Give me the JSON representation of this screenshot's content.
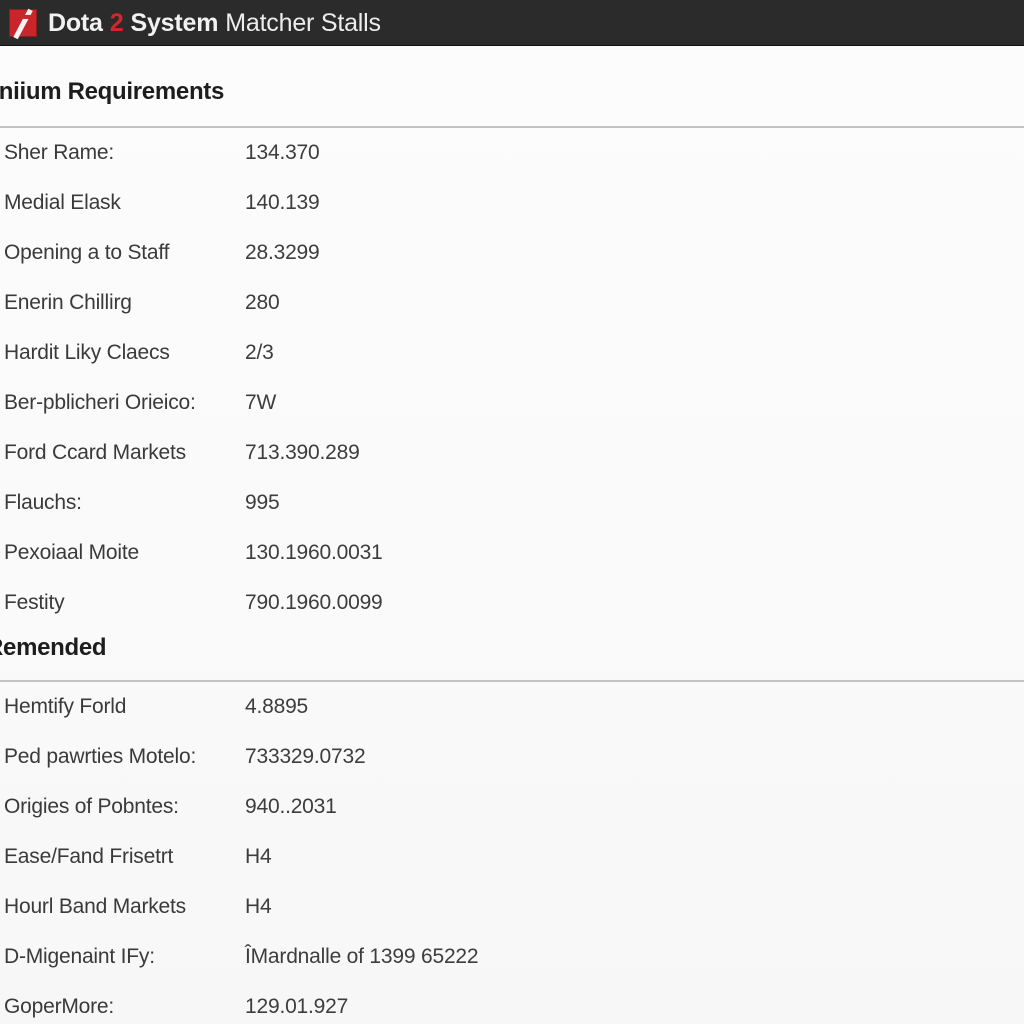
{
  "titlebar": {
    "logo_icon": "dota2-logo-icon",
    "title_part_1": "Dota",
    "title_part_2": "2",
    "title_part_3": "System",
    "title_part_4": "Matcher Stalls"
  },
  "sections": [
    {
      "heading": "Iiniium Requirements",
      "rows": [
        {
          "label": "Sher Rame:",
          "value": "134.370"
        },
        {
          "label": "Medial Elask",
          "value": "140.139"
        },
        {
          "label": "Opening a to Staff",
          "value": "28.3299"
        },
        {
          "label": "Enerin Chillirg",
          "value": "280"
        },
        {
          "label": "Hardit Liky Claecs",
          "value": "2/3"
        },
        {
          "label": "Ber-pblicheri Orieico:",
          "value": "7W"
        },
        {
          "label": "Ford Ccard Markets",
          "value": "713.390.289"
        },
        {
          "label": "Flauchs:",
          "value": "995"
        },
        {
          "label": "Pexoiaal Moite",
          "value": "130.1960.0031"
        },
        {
          "label": "Festity",
          "value": "790.1960.0099"
        }
      ]
    },
    {
      "heading": "Remended",
      "rows": [
        {
          "label": "Hemtify Forld",
          "value": "4.8895"
        },
        {
          "label": "Ped pawrties Motelo:",
          "value": "733329.0732"
        },
        {
          "label": "Origies of Pobntes:",
          "value": "940..2031"
        },
        {
          "label": "Ease/Fand Frisetrt",
          "value": "H4"
        },
        {
          "label": "Hourl Band Markets",
          "value": "H4"
        },
        {
          "label": "D-Migenaint IFy:",
          "value": "ÎMardnalle of 1399 65222"
        },
        {
          "label": "GoperMore:",
          "value": "129.01.927"
        }
      ]
    }
  ],
  "colors": {
    "titlebar_bg": "#2b2b2b",
    "page_bg": "#fbfbfb",
    "accent_red": "#d6262c",
    "logo_red": "#c9252b",
    "divider": "#b9b9b9",
    "label_text": "#3a3a3a",
    "value_text": "#3d3d3d",
    "heading_text": "#1d1d1d"
  }
}
